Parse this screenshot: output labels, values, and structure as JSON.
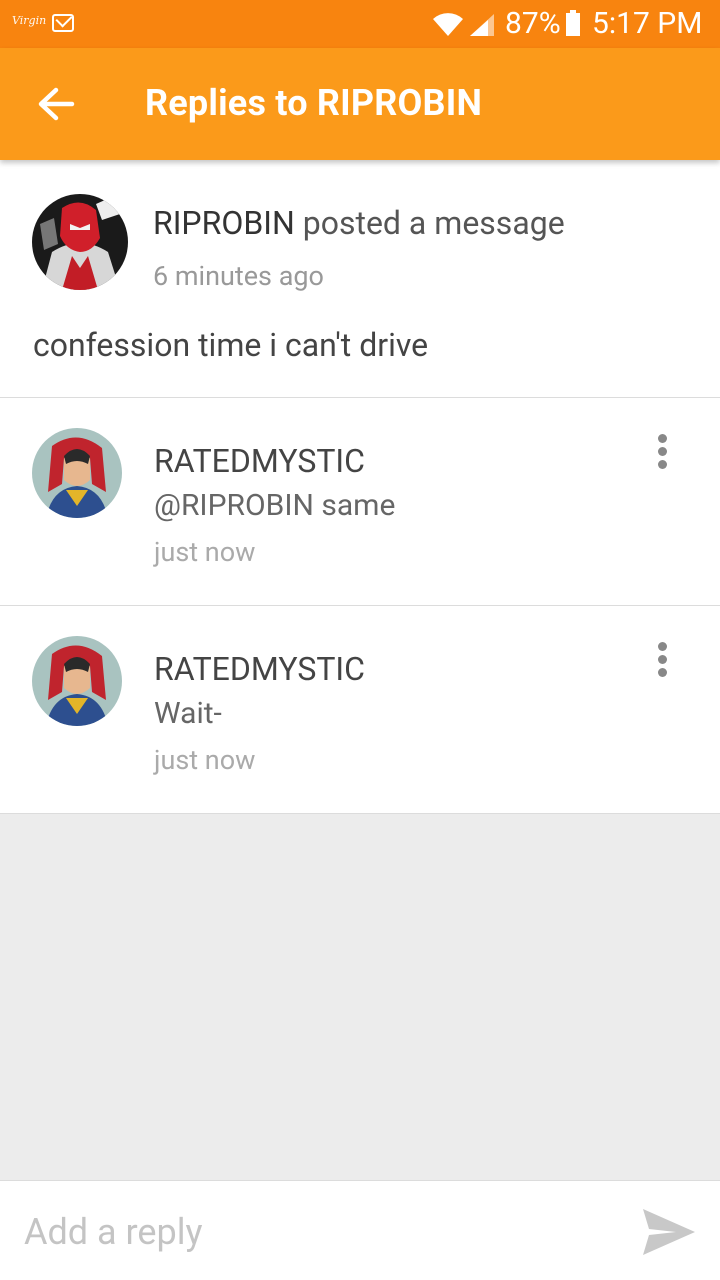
{
  "status_bar": {
    "carrier": "Virgin",
    "battery_percent": "87%",
    "time": "5:17 PM"
  },
  "app_bar": {
    "title": "Replies to RIPROBIN"
  },
  "post": {
    "author": "RIPROBIN",
    "action": "posted a message",
    "time": "6 minutes ago",
    "body": "confession time i can't drive"
  },
  "replies": [
    {
      "user": "RATEDMYSTIC",
      "text": "@RIPROBIN same",
      "time": "just now"
    },
    {
      "user": "RATEDMYSTIC",
      "text": "Wait-",
      "time": "just now"
    }
  ],
  "composer": {
    "placeholder": "Add a reply"
  },
  "colors": {
    "status_bar": "#f8840f",
    "app_bar": "#fb9a1a"
  },
  "icons": [
    "mail-icon",
    "wifi-icon",
    "signal-icon",
    "battery-icon",
    "back-arrow-icon",
    "more-vert-icon",
    "send-icon"
  ]
}
